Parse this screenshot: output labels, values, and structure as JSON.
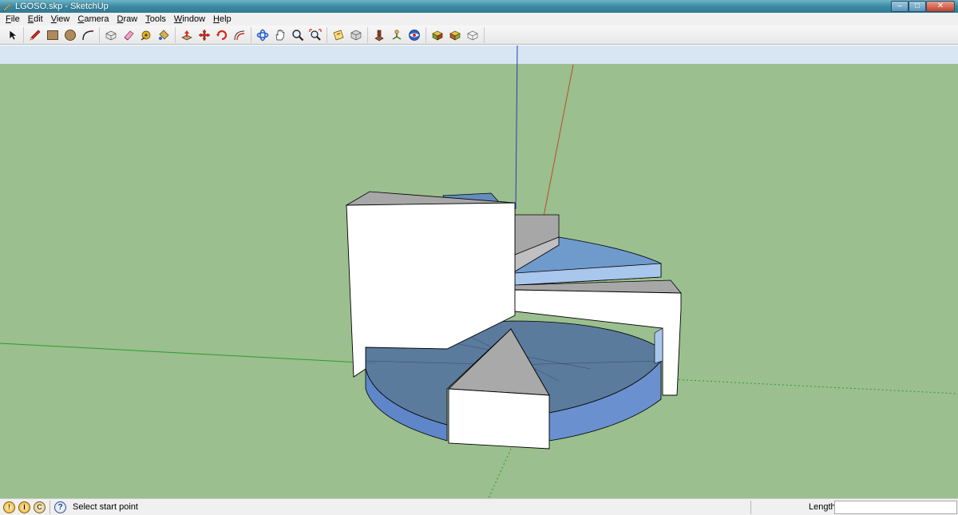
{
  "window": {
    "title": "LGOSO.skp - SketchUp",
    "controls": {
      "minimize": "–",
      "maximize": "□",
      "close": "✕"
    }
  },
  "menu": {
    "items": [
      {
        "label": "File",
        "mnemonic": "F",
        "rest": "ile"
      },
      {
        "label": "Edit",
        "mnemonic": "E",
        "rest": "dit"
      },
      {
        "label": "View",
        "mnemonic": "V",
        "rest": "iew"
      },
      {
        "label": "Camera",
        "mnemonic": "C",
        "rest": "amera"
      },
      {
        "label": "Draw",
        "mnemonic": "D",
        "rest": "raw"
      },
      {
        "label": "Tools",
        "mnemonic": "T",
        "rest": "ools"
      },
      {
        "label": "Window",
        "mnemonic": "W",
        "rest": "indow"
      },
      {
        "label": "Help",
        "mnemonic": "H",
        "rest": "elp"
      }
    ]
  },
  "toolbar": {
    "groups": [
      [
        "select-tool-icon"
      ],
      [
        "pencil-line-icon",
        "rectangle-icon",
        "circle-icon",
        "arc-icon"
      ],
      [
        "make-component-icon",
        "eraser-icon",
        "tape-measure-icon",
        "paint-bucket-icon"
      ],
      [
        "push-pull-icon",
        "move-icon",
        "rotate-icon",
        "offset-icon"
      ],
      [
        "orbit-icon",
        "pan-icon",
        "zoom-icon",
        "zoom-extents-icon"
      ],
      [
        "section-plane-icon",
        "previous-view-icon"
      ],
      [
        "walk-icon",
        "position-camera-icon",
        "look-around-icon"
      ],
      [
        "get-models-icon",
        "share-model-icon",
        "components-warehouse-icon"
      ]
    ]
  },
  "status": {
    "icons": [
      "geo-location-icon",
      "credits-icon",
      "user-icon"
    ],
    "help_symbol": "?",
    "prompt": "Select start point",
    "measurement_label": "Length",
    "measurement_value": ""
  },
  "colors": {
    "sky": "#d7e6f2",
    "ground": "#9bbf8e",
    "blue_axis": "#2a3cb8",
    "red_axis": "#c04a2a",
    "green_axis": "#2f9a2f",
    "translucent_face": "#5b84c8",
    "face_white": "#ffffff",
    "face_gray": "#a7a7a7",
    "edge": "#000000"
  }
}
